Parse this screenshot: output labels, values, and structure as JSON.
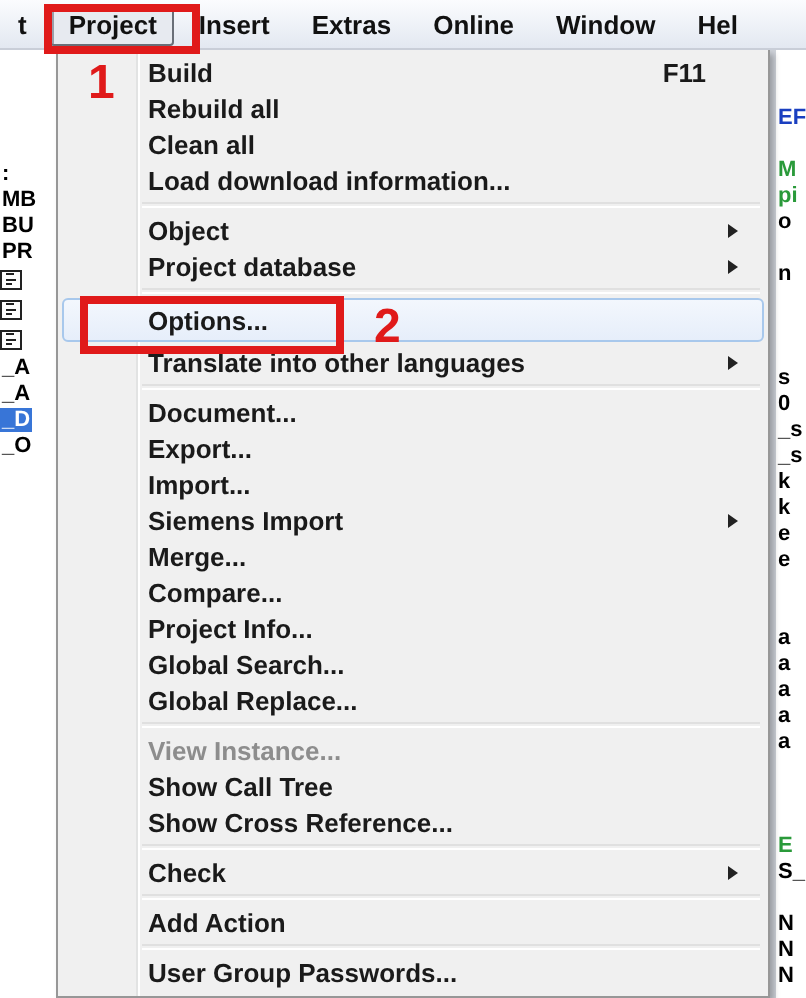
{
  "menu_bar": {
    "items": [
      {
        "label": "t",
        "selected": false
      },
      {
        "label": "Project",
        "selected": true
      },
      {
        "label": "Insert",
        "selected": false
      },
      {
        "label": "Extras",
        "selected": false
      },
      {
        "label": "Online",
        "selected": false
      },
      {
        "label": "Window",
        "selected": false
      },
      {
        "label": "Hel",
        "selected": false
      }
    ]
  },
  "left_pane": {
    "lines": [
      {
        "kind": "gap"
      },
      {
        "kind": "gap"
      },
      {
        "kind": "gap"
      },
      {
        "kind": "gap"
      },
      {
        "kind": "text",
        "text": ":",
        "selected": false
      },
      {
        "kind": "text",
        "text": "MB",
        "selected": false
      },
      {
        "kind": "text",
        "text": "BU",
        "selected": false
      },
      {
        "kind": "text",
        "text": "PR",
        "selected": false
      },
      {
        "kind": "icon"
      },
      {
        "kind": "icon"
      },
      {
        "kind": "icon"
      },
      {
        "kind": "text",
        "text": "_A",
        "selected": false
      },
      {
        "kind": "text",
        "text": "_A",
        "selected": false
      },
      {
        "kind": "text",
        "text": "_D",
        "selected": true
      },
      {
        "kind": "text",
        "text": "_O",
        "selected": false
      }
    ]
  },
  "project_menu": {
    "items": [
      {
        "kind": "item",
        "label": "Build",
        "shortcut": "F11",
        "submenu": false,
        "disabled": false,
        "selected": false
      },
      {
        "kind": "item",
        "label": "Rebuild all",
        "submenu": false,
        "disabled": false,
        "selected": false
      },
      {
        "kind": "item",
        "label": "Clean all",
        "submenu": false,
        "disabled": false,
        "selected": false
      },
      {
        "kind": "item",
        "label": "Load download information...",
        "submenu": false,
        "disabled": false,
        "selected": false
      },
      {
        "kind": "separator"
      },
      {
        "kind": "item",
        "label": "Object",
        "submenu": true,
        "disabled": false,
        "selected": false
      },
      {
        "kind": "item",
        "label": "Project database",
        "submenu": true,
        "disabled": false,
        "selected": false
      },
      {
        "kind": "separator"
      },
      {
        "kind": "item",
        "label": "Options...",
        "submenu": false,
        "disabled": false,
        "selected": true
      },
      {
        "kind": "item",
        "label": "Translate into other languages",
        "submenu": true,
        "disabled": false,
        "selected": false
      },
      {
        "kind": "separator"
      },
      {
        "kind": "item",
        "label": "Document...",
        "submenu": false,
        "disabled": false,
        "selected": false
      },
      {
        "kind": "item",
        "label": "Export...",
        "submenu": false,
        "disabled": false,
        "selected": false
      },
      {
        "kind": "item",
        "label": "Import...",
        "submenu": false,
        "disabled": false,
        "selected": false
      },
      {
        "kind": "item",
        "label": "Siemens Import",
        "submenu": true,
        "disabled": false,
        "selected": false
      },
      {
        "kind": "item",
        "label": "Merge...",
        "submenu": false,
        "disabled": false,
        "selected": false
      },
      {
        "kind": "item",
        "label": "Compare...",
        "submenu": false,
        "disabled": false,
        "selected": false
      },
      {
        "kind": "item",
        "label": "Project Info...",
        "submenu": false,
        "disabled": false,
        "selected": false
      },
      {
        "kind": "item",
        "label": "Global Search...",
        "submenu": false,
        "disabled": false,
        "selected": false
      },
      {
        "kind": "item",
        "label": "Global Replace...",
        "submenu": false,
        "disabled": false,
        "selected": false
      },
      {
        "kind": "separator"
      },
      {
        "kind": "item",
        "label": "View Instance...",
        "submenu": false,
        "disabled": true,
        "selected": false
      },
      {
        "kind": "item",
        "label": "Show Call Tree",
        "submenu": false,
        "disabled": false,
        "selected": false
      },
      {
        "kind": "item",
        "label": "Show Cross Reference...",
        "submenu": false,
        "disabled": false,
        "selected": false
      },
      {
        "kind": "separator"
      },
      {
        "kind": "item",
        "label": "Check",
        "submenu": true,
        "disabled": false,
        "selected": false
      },
      {
        "kind": "separator"
      },
      {
        "kind": "item",
        "label": "Add Action",
        "submenu": false,
        "disabled": false,
        "selected": false
      },
      {
        "kind": "separator"
      },
      {
        "kind": "item",
        "label": "User Group Passwords...",
        "submenu": false,
        "disabled": false,
        "selected": false
      }
    ]
  },
  "right_pane": {
    "lines": [
      {
        "kind": "gap"
      },
      {
        "kind": "gap"
      },
      {
        "kind": "text",
        "text": "EF",
        "color": "#1a3fc0"
      },
      {
        "kind": "gap"
      },
      {
        "kind": "text",
        "text": "M",
        "color": "#2a9a3a"
      },
      {
        "kind": "text",
        "text": "pi",
        "color": "#2a9a3a"
      },
      {
        "kind": "text",
        "text": "o",
        "color": "#000000"
      },
      {
        "kind": "gap"
      },
      {
        "kind": "text",
        "text": "n",
        "color": "#000000"
      },
      {
        "kind": "gap"
      },
      {
        "kind": "gap"
      },
      {
        "kind": "gap"
      },
      {
        "kind": "text",
        "text": "s",
        "color": "#000000"
      },
      {
        "kind": "text",
        "text": "0",
        "color": "#000000"
      },
      {
        "kind": "text",
        "text": "_s",
        "color": "#000000"
      },
      {
        "kind": "text",
        "text": "_s",
        "color": "#000000"
      },
      {
        "kind": "text",
        "text": "k",
        "color": "#000000"
      },
      {
        "kind": "text",
        "text": "k",
        "color": "#000000"
      },
      {
        "kind": "text",
        "text": "e",
        "color": "#000000"
      },
      {
        "kind": "text",
        "text": "e",
        "color": "#000000"
      },
      {
        "kind": "gap"
      },
      {
        "kind": "gap"
      },
      {
        "kind": "text",
        "text": "a",
        "color": "#000000"
      },
      {
        "kind": "text",
        "text": "a",
        "color": "#000000"
      },
      {
        "kind": "text",
        "text": "a",
        "color": "#000000"
      },
      {
        "kind": "text",
        "text": "a",
        "color": "#000000"
      },
      {
        "kind": "text",
        "text": "a",
        "color": "#000000"
      },
      {
        "kind": "gap"
      },
      {
        "kind": "gap"
      },
      {
        "kind": "gap"
      },
      {
        "kind": "text",
        "text": "E",
        "color": "#2a9a3a"
      },
      {
        "kind": "text",
        "text": "S_",
        "color": "#000000"
      },
      {
        "kind": "gap"
      },
      {
        "kind": "text",
        "text": "N",
        "color": "#000000"
      },
      {
        "kind": "text",
        "text": "N",
        "color": "#000000"
      },
      {
        "kind": "text",
        "text": "N",
        "color": "#000000"
      }
    ]
  },
  "annotations": [
    {
      "label": "1"
    },
    {
      "label": "2"
    }
  ]
}
